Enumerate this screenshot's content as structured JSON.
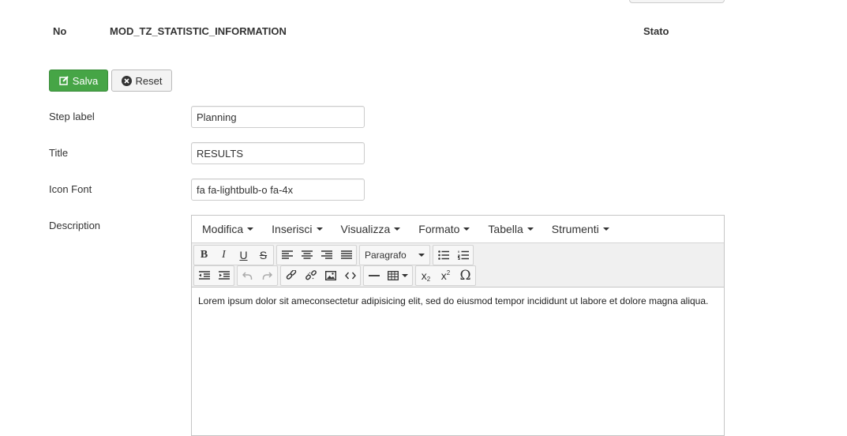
{
  "table_header": {
    "col_no": "No",
    "col_info": "MOD_TZ_STATISTIC_INFORMATION",
    "col_status": "Stato"
  },
  "actions": {
    "save_label": "Salva",
    "reset_label": "Reset",
    "save_color": "#46a546"
  },
  "form": {
    "step_label": {
      "label": "Step label",
      "value": "Planning"
    },
    "title": {
      "label": "Title",
      "value": "RESULTS"
    },
    "icon_font": {
      "label": "Icon Font",
      "value": "fa fa-lightbulb-o fa-4x"
    },
    "description": {
      "label": "Description"
    }
  },
  "editor": {
    "menus": [
      "Modifica",
      "Inserisci",
      "Visualizza",
      "Formato",
      "Tabella",
      "Strumenti"
    ],
    "format_select": "Paragrafo",
    "content": "Lorem ipsum dolor sit ameconsectetur adipisicing elit, sed do eiusmod tempor incididunt ut labore et dolore magna aliqua."
  }
}
